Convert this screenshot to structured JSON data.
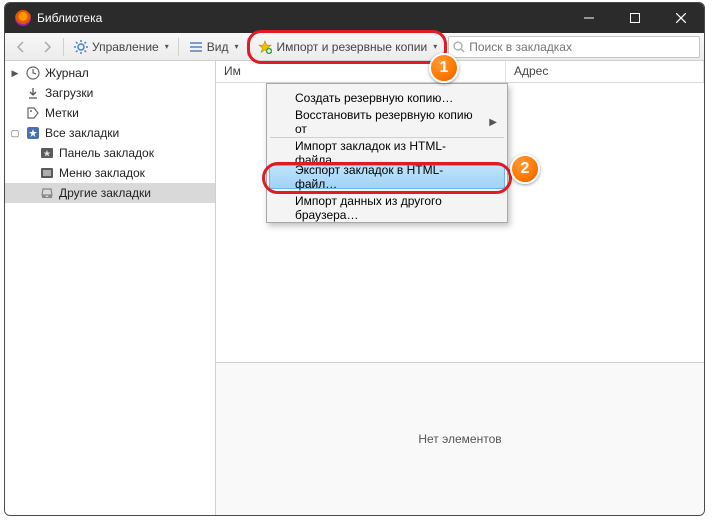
{
  "window": {
    "title": "Библиотека"
  },
  "toolbar": {
    "manage_label": "Управление",
    "view_label": "Вид",
    "import_label": "Импорт и резервные копии",
    "search_placeholder": "Поиск в закладках"
  },
  "sidebar": {
    "items": [
      {
        "label": "Журнал"
      },
      {
        "label": "Загрузки"
      },
      {
        "label": "Метки"
      },
      {
        "label": "Все закладки"
      },
      {
        "label": "Панель закладок"
      },
      {
        "label": "Меню закладок"
      },
      {
        "label": "Другие закладки"
      }
    ]
  },
  "columns": {
    "c1_prefix": "Им",
    "c2": "Адрес"
  },
  "menu": {
    "items": [
      "Создать резервную копию…",
      "Восстановить резервную копию от",
      "Импорт закладок из HTML-файла…",
      "Экспорт закладок в HTML-файл…",
      "Импорт данных из другого браузера…"
    ]
  },
  "empty": "Нет элементов"
}
